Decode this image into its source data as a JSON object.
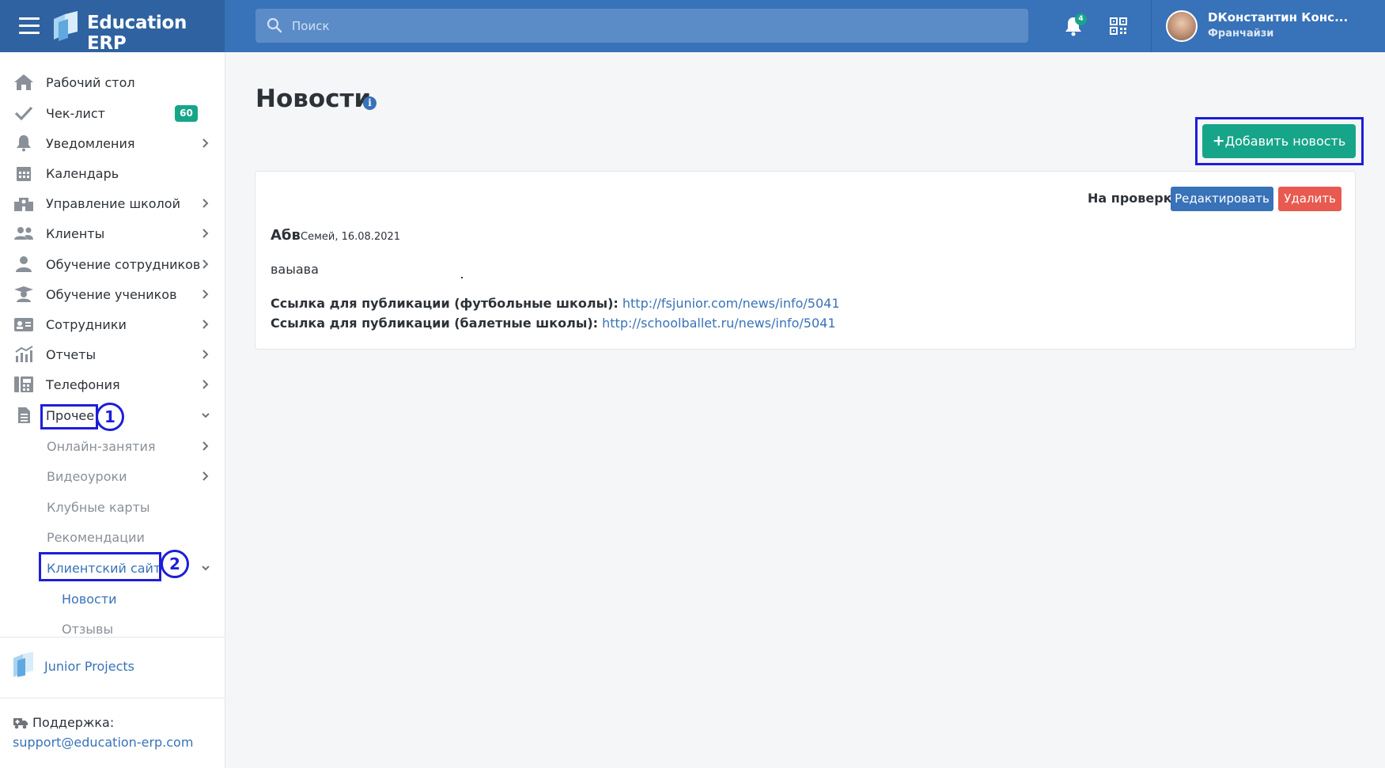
{
  "app": {
    "brand": "Education ERP"
  },
  "search": {
    "placeholder": "Поиск"
  },
  "notifications": {
    "badge": "4"
  },
  "user": {
    "name": "DКонстантин Конс...",
    "role": "Франчайзи"
  },
  "sidebar": {
    "items": [
      {
        "label": "Рабочий стол",
        "icon": "home-icon"
      },
      {
        "label": "Чек-лист",
        "icon": "check-icon",
        "badge": "60"
      },
      {
        "label": "Уведомления",
        "icon": "bell-icon"
      },
      {
        "label": "Календарь",
        "icon": "calendar-icon"
      },
      {
        "label": "Управление школой",
        "icon": "school-icon"
      },
      {
        "label": "Клиенты",
        "icon": "users-icon"
      },
      {
        "label": "Обучение сотрудников",
        "icon": "user-tie-icon"
      },
      {
        "label": "Обучение учеников",
        "icon": "graduate-icon"
      },
      {
        "label": "Сотрудники",
        "icon": "id-card-icon"
      },
      {
        "label": "Отчеты",
        "icon": "chart-icon"
      },
      {
        "label": "Телефония",
        "icon": "fax-icon"
      },
      {
        "label": "Прочее",
        "icon": "document-icon"
      }
    ],
    "sub_items": [
      {
        "label": "Онлайн-занятия"
      },
      {
        "label": "Видеоуроки"
      },
      {
        "label": "Клубные карты"
      },
      {
        "label": "Рекомендации"
      },
      {
        "label": "Клиентский сайт"
      }
    ],
    "sub2_items": [
      {
        "label": "Новости"
      },
      {
        "label": "Отзывы"
      }
    ],
    "footer": {
      "project": "Junior Projects",
      "support_label": "Поддержка:",
      "support_email": "support@education-erp.com"
    }
  },
  "annotations": {
    "step1": "1",
    "step2": "2"
  },
  "main": {
    "title": "Новости",
    "info_icon": "i",
    "add_button": "Добавить новость",
    "news": [
      {
        "status": "На проверке",
        "edit": "Редактировать",
        "delete": "Удалить",
        "title": "Абв",
        "meta": "Семей, 16.08.2021",
        "body": "ваыава",
        "link1_label": "Ссылка для публикации (футбольные школы):",
        "link1_url": "http://fsjunior.com/news/info/5041",
        "link2_label": "Ссылка для публикации (балетные школы):",
        "link2_url": "http://schoolballet.ru/news/info/5041"
      }
    ]
  },
  "colors": {
    "topbar": "#3872b8",
    "brand_bg": "#2f62a0",
    "accent_green": "#17a589",
    "edit_blue": "#3872b8",
    "delete_red": "#e85a4f",
    "highlight": "#1d1ed8"
  }
}
